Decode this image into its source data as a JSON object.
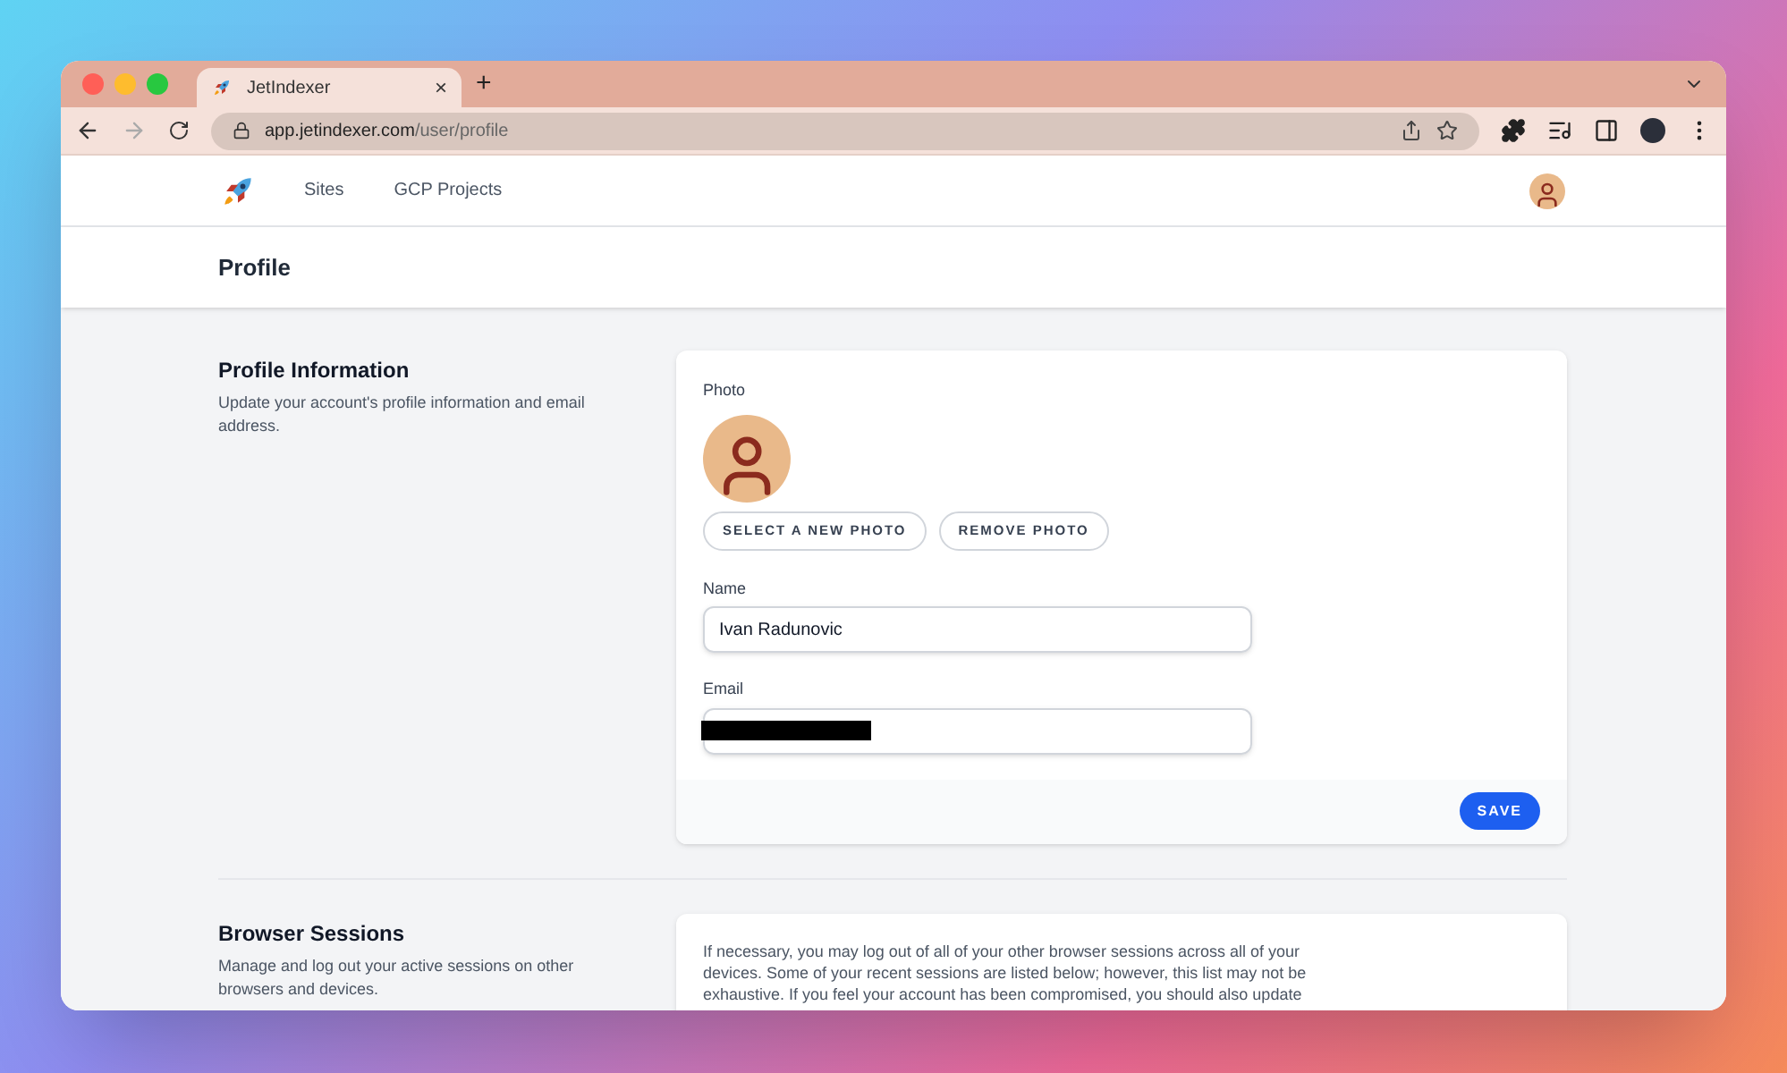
{
  "browser": {
    "tab": {
      "title": "JetIndexer",
      "close": "×"
    },
    "new_tab": "+",
    "url_host": "app.jetindexer.com",
    "url_path": "/user/profile"
  },
  "nav": {
    "items": [
      {
        "label": "Sites"
      },
      {
        "label": "GCP Projects"
      }
    ]
  },
  "page_title": "Profile",
  "profile_section": {
    "title": "Profile Information",
    "description": "Update your account's profile information and email address.",
    "photo_label": "Photo",
    "buttons": [
      "SELECT A NEW PHOTO",
      "REMOVE PHOTO"
    ],
    "name_label": "Name",
    "name_value": "Ivan Radunovic",
    "email_label": "Email",
    "email_redacted": true,
    "save": "SAVE"
  },
  "sessions_section": {
    "title": "Browser Sessions",
    "description": "Manage and log out your active sessions on other browsers and devices.",
    "text": "If necessary, you may log out of all of your other browser sessions across all of your devices. Some of your recent sessions are listed below; however, this list may not be exhaustive. If you feel your account has been compromised, you should also update"
  }
}
